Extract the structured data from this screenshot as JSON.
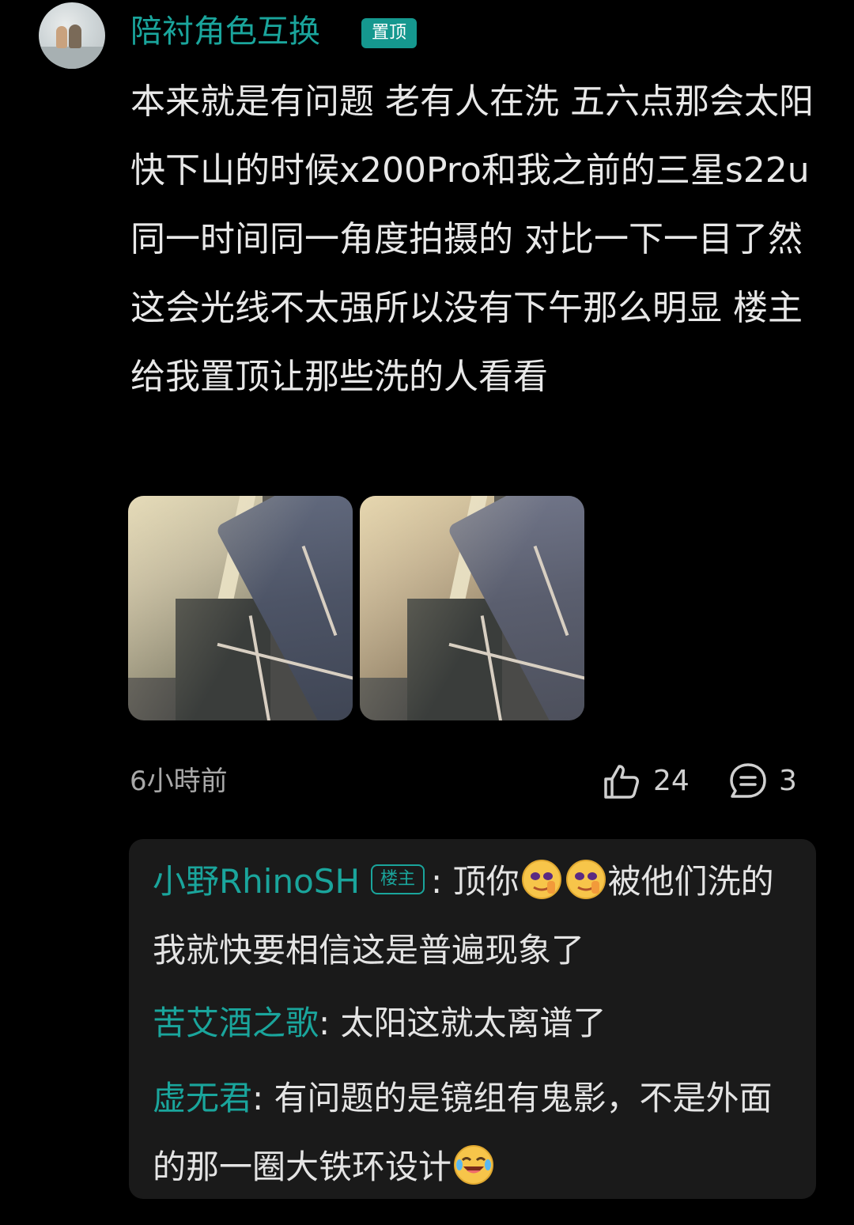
{
  "comment": {
    "author": "陪衬角色互换",
    "badge": "置顶",
    "text": "本来就是有问题 老有人在洗 五六点那会太阳快下山的时候x200Pro和我之前的三星s22u 同一时间同一角度拍摄的 对比一下一目了然 这会光线不太强所以没有下午那么明显 楼主给我置顶让那些洗的人看看",
    "time": "6小時前",
    "likes": "24",
    "replies_count": "3"
  },
  "replies": [
    {
      "name": "小野RhinoSH",
      "badge": "楼主",
      "sep": ": ",
      "text_before": "顶你",
      "emojis": [
        "shush-emoji",
        "shush-emoji"
      ],
      "text_after": "被他们洗的我就快要相信这是普遍现象了"
    },
    {
      "name": "苦艾酒之歌",
      "sep": ": ",
      "text": "太阳这就太离谱了"
    },
    {
      "name": "虚无君",
      "sep": ": ",
      "text": "有问题的是镜组有鬼影，不是外面的那一圈大铁环设计",
      "emoji": "laughing-tears-emoji"
    }
  ],
  "colors": {
    "accent": "#1aa59c",
    "background": "#000000",
    "reply_panel": "#1a1a1a"
  }
}
